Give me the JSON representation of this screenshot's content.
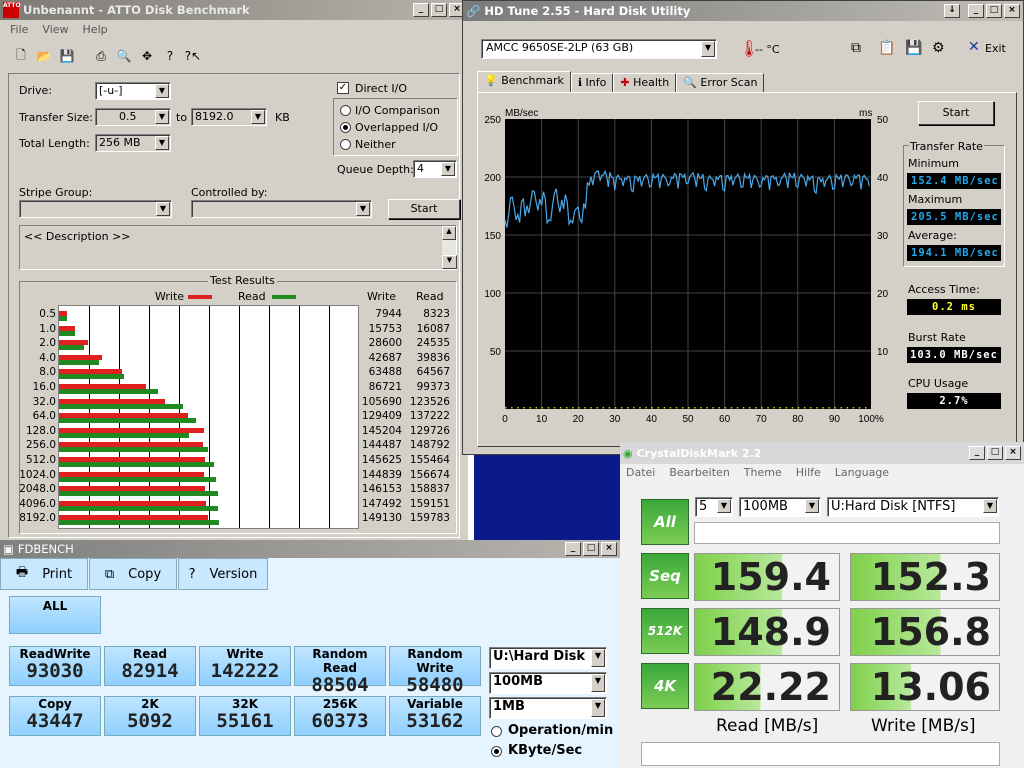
{
  "atto": {
    "title": "Unbenannt - ATTO Disk Benchmark",
    "menu": [
      "File",
      "View",
      "Help"
    ],
    "drive_label": "Drive:",
    "drive_value": "[-u-]",
    "transfer_size_label": "Transfer Size:",
    "transfer_from": "0.5",
    "to_label": "to",
    "transfer_to": "8192.0",
    "kb_label": "KB",
    "total_length_label": "Total Length:",
    "total_length_value": "256 MB",
    "direct_io_label": "Direct I/O",
    "io_comparison_label": "I/O Comparison",
    "overlapped_io_label": "Overlapped I/O",
    "neither_label": "Neither",
    "queue_depth_label": "Queue Depth:",
    "queue_depth_value": "4",
    "stripe_group_label": "Stripe Group:",
    "controlled_by_label": "Controlled by:",
    "start_label": "Start",
    "description_text": "<< Description >>",
    "results_title": "Test Results",
    "legend_write": "Write",
    "legend_read": "Read",
    "col_write": "Write",
    "col_read": "Read",
    "colors": {
      "write": "#e02020",
      "read": "#208a20"
    },
    "rows": [
      {
        "size": "0.5",
        "write": "7944",
        "read": "8323"
      },
      {
        "size": "1.0",
        "write": "15753",
        "read": "16087"
      },
      {
        "size": "2.0",
        "write": "28600",
        "read": "24535"
      },
      {
        "size": "4.0",
        "write": "42687",
        "read": "39836"
      },
      {
        "size": "8.0",
        "write": "63488",
        "read": "64567"
      },
      {
        "size": "16.0",
        "write": "86721",
        "read": "99373"
      },
      {
        "size": "32.0",
        "write": "105690",
        "read": "123526"
      },
      {
        "size": "64.0",
        "write": "129409",
        "read": "137222"
      },
      {
        "size": "128.0",
        "write": "145204",
        "read": "129726"
      },
      {
        "size": "256.0",
        "write": "144487",
        "read": "148792"
      },
      {
        "size": "512.0",
        "write": "145625",
        "read": "155464"
      },
      {
        "size": "1024.0",
        "write": "144839",
        "read": "156674"
      },
      {
        "size": "2048.0",
        "write": "146153",
        "read": "158837"
      },
      {
        "size": "4096.0",
        "write": "147492",
        "read": "159151"
      },
      {
        "size": "8192.0",
        "write": "149130",
        "read": "159783"
      }
    ]
  },
  "hdtune": {
    "title": "HD Tune 2.55 - Hard Disk Utility",
    "drive": "AMCC    9650SE-2LP (63 GB)",
    "temp": "-- °C",
    "exit_label": "Exit",
    "tabs": [
      "Benchmark",
      "Info",
      "Health",
      "Error Scan"
    ],
    "start_label": "Start",
    "transfer_rate_label": "Transfer Rate",
    "minimum_label": "Minimum",
    "minimum_value": "152.4 MB/sec",
    "maximum_label": "Maximum",
    "maximum_value": "205.5 MB/sec",
    "average_label": "Average:",
    "average_value": "194.1 MB/sec",
    "access_time_label": "Access Time:",
    "access_time_value": "0.2 ms",
    "burst_rate_label": "Burst Rate",
    "burst_rate_value": "103.0 MB/sec",
    "cpu_usage_label": "CPU Usage",
    "cpu_usage_value": "2.7%"
  },
  "chart_data": {
    "type": "line",
    "ylabel": "MB/sec",
    "y2label": "ms",
    "ylim": [
      0,
      250
    ],
    "y2lim": [
      0,
      50
    ],
    "y_ticks": [
      "250",
      "200",
      "150",
      "100",
      "50"
    ],
    "y2_ticks": [
      "50",
      "40",
      "30",
      "20",
      "10"
    ],
    "x_ticks": [
      "0",
      "10",
      "20",
      "30",
      "40",
      "50",
      "60",
      "70",
      "80",
      "90",
      "100%"
    ],
    "grid": true,
    "series": [
      {
        "x": [
          0,
          2,
          4,
          6,
          8,
          10,
          12,
          14,
          16,
          18,
          20,
          22,
          23,
          24,
          26,
          30,
          35,
          40,
          45,
          50,
          55,
          60,
          65,
          70,
          75,
          80,
          85,
          90,
          95,
          100
        ],
        "values": [
          163,
          170,
          172,
          178,
          174,
          185,
          168,
          176,
          180,
          170,
          160,
          178,
          196,
          204,
          203,
          200,
          199,
          201,
          200,
          202,
          199,
          200,
          201,
          199,
          200,
          201,
          198,
          200,
          201,
          199
        ]
      }
    ]
  },
  "cdm": {
    "title": "CrystalDiskMark 2.2",
    "menu": [
      "Datei",
      "Bearbeiten",
      "Theme",
      "Hilfe",
      "Language"
    ],
    "all_label": "All",
    "runs": "5",
    "size": "100MB",
    "drive": "U:Hard Disk [NTFS]",
    "rows": [
      {
        "label": "Seq",
        "read": "159.4",
        "write": "152.3"
      },
      {
        "label": "512K",
        "read": "148.9",
        "write": "156.8"
      },
      {
        "label": "4K",
        "read": "22.22",
        "write": "13.06"
      }
    ],
    "read_label": "Read [MB/s]",
    "write_label": "Write [MB/s]"
  },
  "fdbench": {
    "title": "FDBENCH",
    "print_label": "Print",
    "copy_label": "Copy",
    "version_label": "Version",
    "all_label": "ALL",
    "row1": [
      {
        "h": "ReadWrite",
        "v": "93030"
      },
      {
        "h": "Read",
        "v": "82914"
      },
      {
        "h": "Write",
        "v": "142222"
      },
      {
        "h": "Random Read",
        "v": "88504"
      },
      {
        "h": "Random Write",
        "v": "58480"
      }
    ],
    "row2": [
      {
        "h": "Copy",
        "v": "43447"
      },
      {
        "h": "2K",
        "v": "5092"
      },
      {
        "h": "32K",
        "v": "55161"
      },
      {
        "h": "256K",
        "v": "60373"
      },
      {
        "h": "Variable",
        "v": "53162"
      }
    ],
    "drive": "U:\\Hard Disk",
    "size": "100MB",
    "block": "1MB",
    "op_label": "Operation/min",
    "kb_label": "KByte/Sec"
  }
}
